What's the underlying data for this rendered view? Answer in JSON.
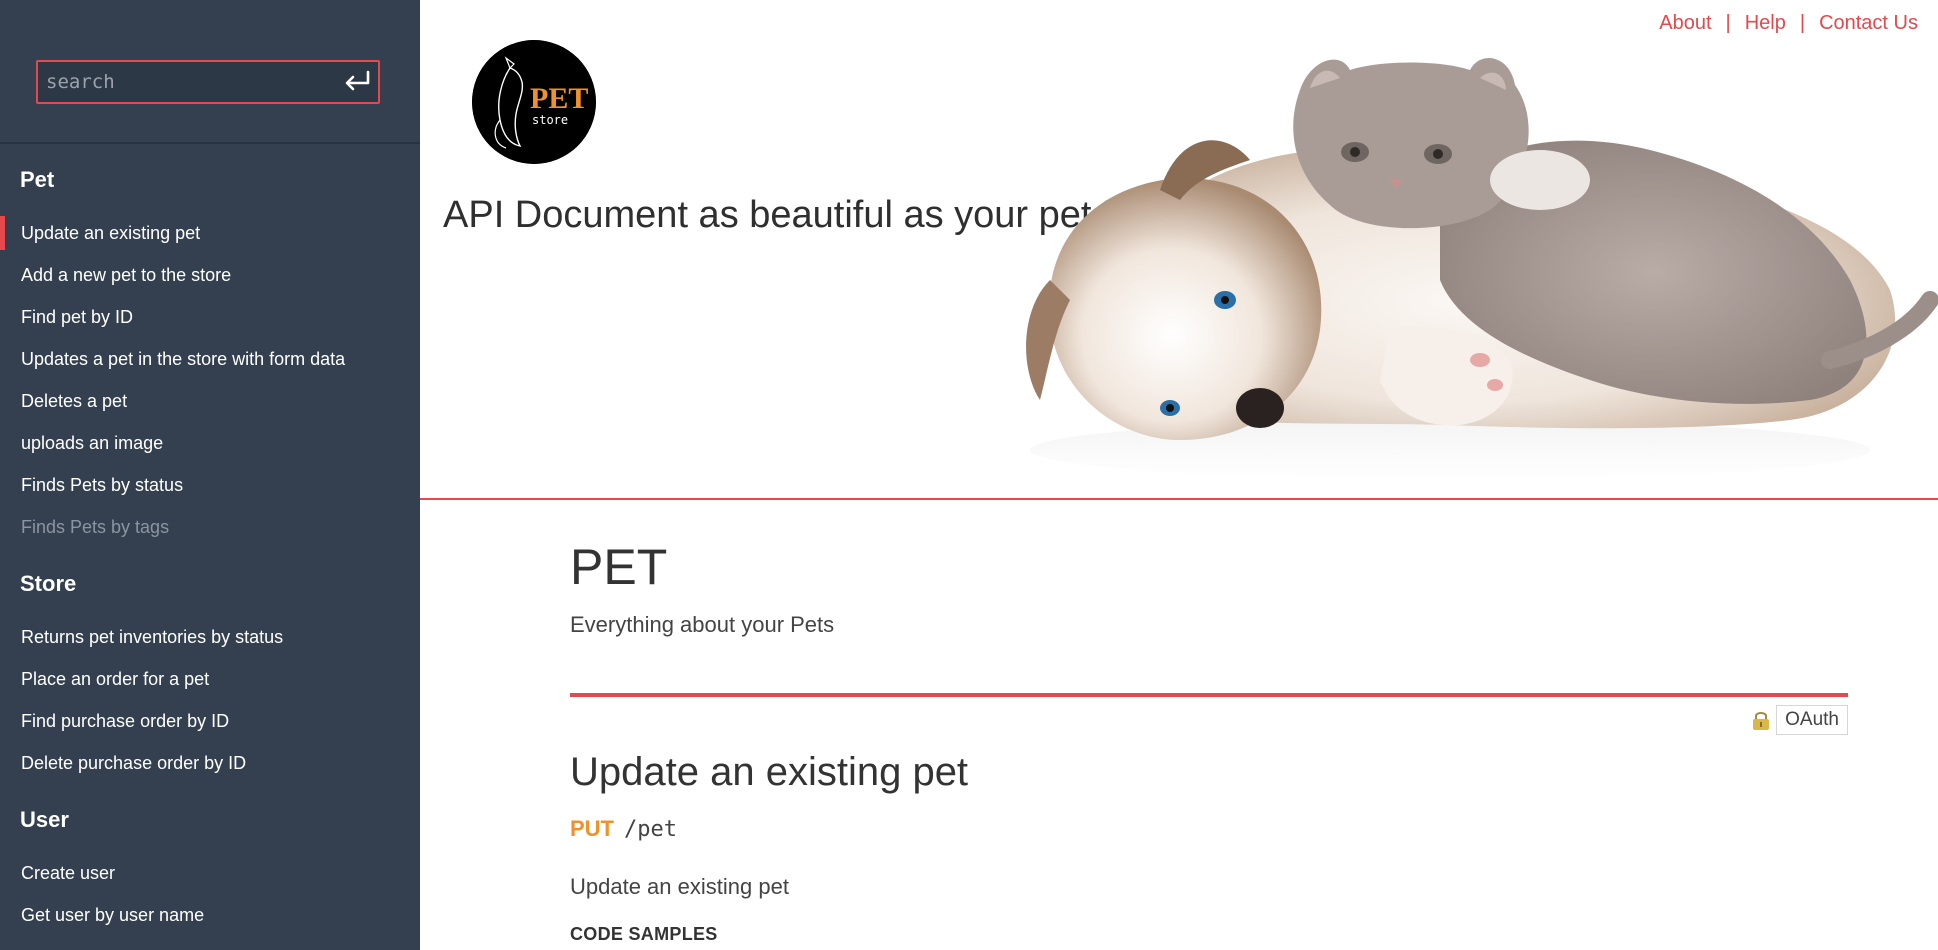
{
  "search": {
    "placeholder": "search"
  },
  "nav": {
    "sections": [
      {
        "title": "Pet",
        "items": [
          "Update an existing pet",
          "Add a new pet to the store",
          "Find pet by ID",
          "Updates a pet in the store with form data",
          "Deletes a pet",
          "uploads an image",
          "Finds Pets by status",
          "Finds Pets by tags"
        ]
      },
      {
        "title": "Store",
        "items": [
          "Returns pet inventories by status",
          "Place an order for a pet",
          "Find purchase order by ID",
          "Delete purchase order by ID"
        ]
      },
      {
        "title": "User",
        "items": [
          "Create user",
          "Get user by user name"
        ]
      }
    ],
    "active_item": "Update an existing pet",
    "dim_item": "Finds Pets by tags"
  },
  "top_links": {
    "about": "About",
    "help": "Help",
    "contact": "Contact Us",
    "separator": "|"
  },
  "logo": {
    "text_pet": "PET",
    "text_store": "store"
  },
  "header": {
    "tagline": "API Document as beautiful as your pet !!!"
  },
  "section": {
    "title": "PET",
    "description": "Everything about your Pets",
    "auth_label": "OAuth"
  },
  "operation": {
    "title": "Update an existing pet",
    "method": "PUT",
    "path": "/pet",
    "description": "Update an existing pet",
    "code_samples_label": "CODE SAMPLES"
  },
  "colors": {
    "accent": "#e5484d",
    "sidebar_bg": "#34404f",
    "method_put": "#f0922c",
    "logo_orange": "#f0922c"
  },
  "icons": {
    "search_submit": "enter-arrow-icon",
    "auth": "lock-icon",
    "hero": "puppy-and-kitten-image"
  }
}
